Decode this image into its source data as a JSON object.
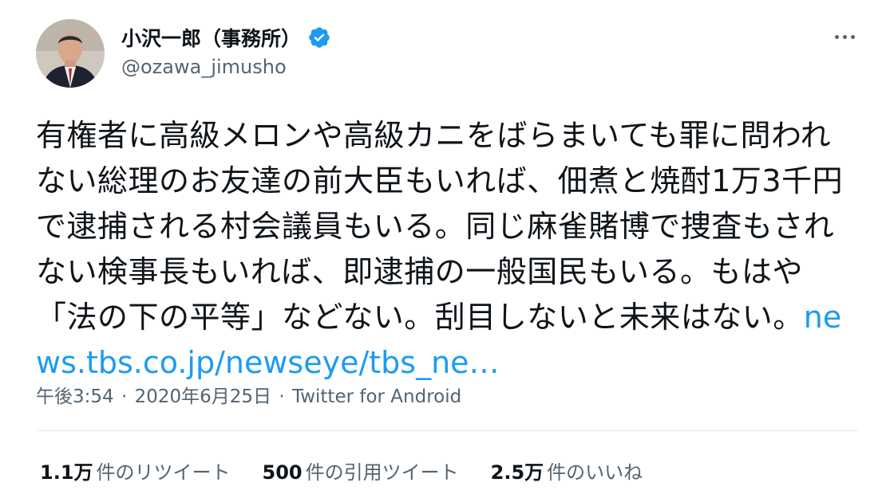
{
  "user": {
    "display_name": "小沢一郎（事務所）",
    "handle": "@ozawa_jimusho",
    "verified": true
  },
  "tweet": {
    "text": "有権者に高級メロンや高級カニをばらまいても罪に問われない総理のお友達の前大臣もいれば、佃煮と焼酎1万3千円で逮捕される村会議員もいる。同じ麻雀賭博で捜査もされない検事長もいれば、即逮捕の一般国民もいる。もはや「法の下の平等」などない。刮目しないと未来はない。",
    "link_text": "news.tbs.co.jp/newseye/tbs_ne…"
  },
  "meta": {
    "time": "午後3:54",
    "date": "2020年6月25日",
    "separator": "·",
    "source": "Twitter for Android"
  },
  "stats": [
    {
      "count": "1.1万",
      "label": "件のリツイート"
    },
    {
      "count": "500",
      "label": "件の引用ツイート"
    },
    {
      "count": "2.5万",
      "label": "件のいいね"
    }
  ],
  "colors": {
    "link": "#1d9bf0",
    "verified_badge": "#1d9bf0",
    "secondary_text": "#536471",
    "primary_text": "#0f1419"
  },
  "icons": {
    "verified": "verified-badge-icon",
    "more": "more-options-icon"
  }
}
